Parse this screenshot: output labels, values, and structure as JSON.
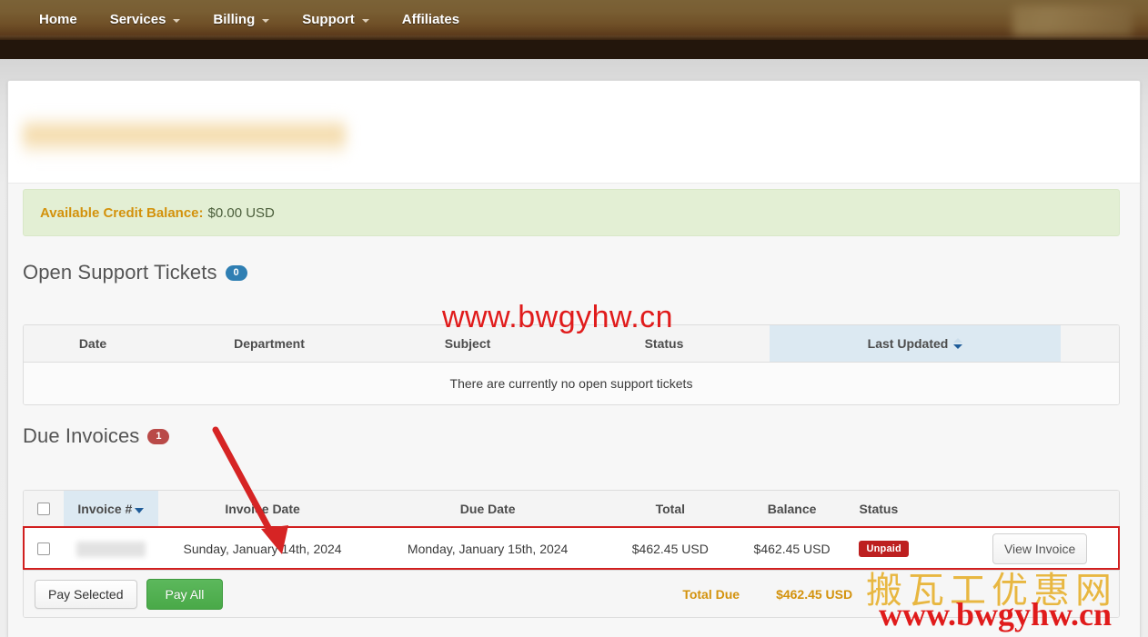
{
  "navbar": {
    "items": [
      {
        "label": "Home",
        "has_dropdown": false
      },
      {
        "label": "Services",
        "has_dropdown": true
      },
      {
        "label": "Billing",
        "has_dropdown": true
      },
      {
        "label": "Support",
        "has_dropdown": true
      },
      {
        "label": "Affiliates",
        "has_dropdown": false
      }
    ],
    "account_menu_redacted": true,
    "background_color": "#6f4f27"
  },
  "page": {
    "title_redacted": true
  },
  "credit_alert": {
    "label": "Available Credit Balance:",
    "value": "$0.00 USD",
    "background_color": "#e3efd4",
    "label_color": "#d3920c"
  },
  "support_tickets": {
    "heading": "Open Support Tickets",
    "count": "0",
    "badge_color": "#2f7fb3",
    "columns": [
      "Date",
      "Department",
      "Subject",
      "Status",
      "Last Updated",
      ""
    ],
    "sorted_column": "Last Updated",
    "sort_direction": "descending",
    "empty_message": "There are currently no open support tickets",
    "rows": []
  },
  "due_invoices": {
    "heading": "Due Invoices",
    "count": "1",
    "badge_color": "#b94a48",
    "columns": [
      "",
      "Invoice #",
      "Invoice Date",
      "Due Date",
      "Total",
      "Balance",
      "Status",
      ""
    ],
    "sorted_column": "Invoice #",
    "sort_direction": "descending",
    "rows": [
      {
        "selected": false,
        "invoice_number_redacted": true,
        "invoice_date": "Sunday, January 14th, 2024",
        "due_date": "Monday, January 15th, 2024",
        "total": "$462.45 USD",
        "balance": "$462.45 USD",
        "status": "Unpaid",
        "status_color": "#bd1f1f",
        "action_label": "View Invoice",
        "highlighted": true
      }
    ],
    "footer": {
      "pay_selected_label": "Pay Selected",
      "pay_all_label": "Pay All",
      "pay_all_color": "#5cb85c",
      "total_due_label": "Total Due",
      "total_due_value": "$462.45 USD",
      "total_due_color": "#d3920c"
    }
  },
  "annotations": {
    "arrow_color": "#d62424",
    "arrow_target": "Invoice Date column"
  },
  "watermarks": {
    "top_center": "www.bwgyhw.cn",
    "bottom_chinese": "搬瓦工优惠网",
    "bottom_url": "www.bwgyhw.cn",
    "red_color": "#e01b1b",
    "gold_color": "#e8b53a"
  }
}
